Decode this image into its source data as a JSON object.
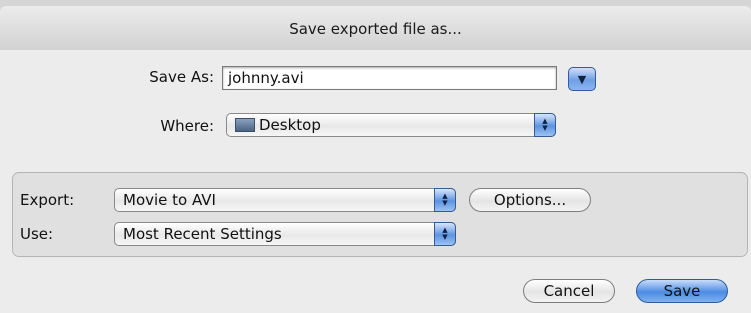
{
  "window": {
    "title": "Save exported file as..."
  },
  "save_as": {
    "label": "Save As:",
    "value": "johnny.avi"
  },
  "where": {
    "label": "Where:",
    "selected": "Desktop",
    "icon": "folder-icon"
  },
  "export": {
    "label": "Export:",
    "selected": "Movie to AVI",
    "options_label": "Options..."
  },
  "use": {
    "label": "Use:",
    "selected": "Most Recent Settings"
  },
  "buttons": {
    "cancel": "Cancel",
    "save": "Save"
  },
  "colors": {
    "accent": "#5b95e3",
    "panel": "#e0e0e0"
  }
}
